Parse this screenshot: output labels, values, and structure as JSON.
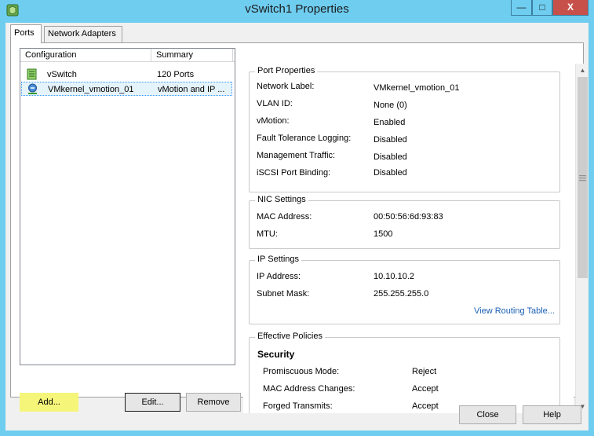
{
  "window": {
    "title": "vSwitch1 Properties",
    "minimize_glyph": "—",
    "maximize_glyph": "□",
    "close_glyph": "X"
  },
  "tabs": [
    {
      "label": "Ports",
      "selected": true
    },
    {
      "label": "Network Adapters",
      "selected": false
    }
  ],
  "ports_list": {
    "columns": [
      "Configuration",
      "Summary"
    ],
    "rows": [
      {
        "icon": "vswitch-icon",
        "configuration": "vSwitch",
        "summary": "120 Ports",
        "selected": false
      },
      {
        "icon": "vmkernel-port-icon",
        "configuration": "VMkernel_vmotion_01",
        "summary": "vMotion and IP ...",
        "selected": true
      }
    ]
  },
  "list_buttons": {
    "add": "Add...",
    "edit": "Edit...",
    "remove": "Remove"
  },
  "port_properties": {
    "title": "Port Properties",
    "items": [
      {
        "label": "Network Label:",
        "value": "VMkernel_vmotion_01"
      },
      {
        "label": "VLAN ID:",
        "value": "None (0)"
      },
      {
        "label": "vMotion:",
        "value": "Enabled"
      },
      {
        "label": "Fault Tolerance Logging:",
        "value": "Disabled"
      },
      {
        "label": "Management Traffic:",
        "value": "Disabled"
      },
      {
        "label": "iSCSI Port Binding:",
        "value": "Disabled"
      }
    ]
  },
  "nic_settings": {
    "title": "NIC Settings",
    "items": [
      {
        "label": "MAC Address:",
        "value": "00:50:56:6d:93:83"
      },
      {
        "label": "MTU:",
        "value": "1500"
      }
    ]
  },
  "ip_settings": {
    "title": "IP Settings",
    "items": [
      {
        "label": "IP Address:",
        "value": "10.10.10.2"
      },
      {
        "label": "Subnet Mask:",
        "value": "255.255.255.0"
      }
    ],
    "routing_link": "View Routing Table..."
  },
  "effective_policies": {
    "title": "Effective Policies",
    "security_title": "Security",
    "items": [
      {
        "label": "Promiscuous Mode:",
        "value": "Reject"
      },
      {
        "label": "MAC Address Changes:",
        "value": "Accept"
      },
      {
        "label": "Forged Transmits:",
        "value": "Accept"
      }
    ]
  },
  "dialog_buttons": {
    "close": "Close",
    "help": "Help"
  },
  "colors": {
    "title_bar": "#6fcdf0",
    "close_button": "#c7504b",
    "highlight": "#f5f57a",
    "link": "#1a5fb4",
    "selection": "#e5f3fb"
  },
  "scrollbar": {
    "position_fraction": 0
  }
}
